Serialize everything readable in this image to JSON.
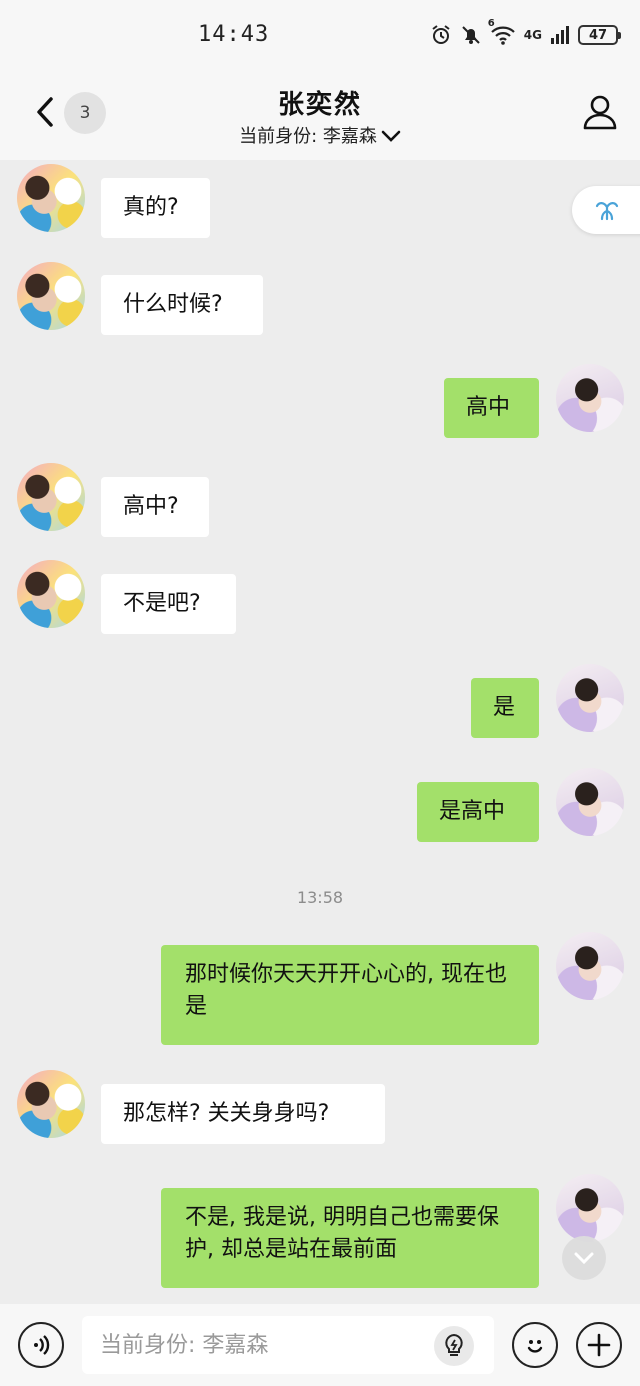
{
  "status_bar": {
    "time": "14:43",
    "network_label": "4G",
    "signal_label": "6",
    "battery": "47"
  },
  "header": {
    "unread_count": "3",
    "title": "张奕然",
    "identity_label": "当前身份: 李嘉森"
  },
  "messages": [
    {
      "side": "left",
      "text": "真的?"
    },
    {
      "side": "left",
      "text": "什么时候?"
    },
    {
      "side": "right",
      "text": "高中"
    },
    {
      "side": "left",
      "text": "高中?"
    },
    {
      "side": "left",
      "text": "不是吧?"
    },
    {
      "side": "right",
      "text": "是"
    },
    {
      "side": "right",
      "text": "是高中"
    },
    {
      "side": "right",
      "text": "那时候你天天开开心心的, 现在也是"
    },
    {
      "side": "left",
      "text": "那怎样? 关关身身吗?"
    },
    {
      "side": "right",
      "text": "不是, 我是说, 明明自己也需要保护, 却总是站在最前面"
    }
  ],
  "time_divider": "13:58",
  "input_bar": {
    "placeholder": "当前身份: 李嘉森"
  },
  "colors": {
    "background": "#ededed",
    "bubble_self": "#a3e06a",
    "bubble_other": "#ffffff"
  },
  "icons": [
    "back-arrow-icon",
    "person-icon",
    "chevron-down-icon",
    "voice-icon",
    "bulb-icon",
    "emoji-icon",
    "plus-icon",
    "chevron-down-icon",
    "alarm-icon",
    "mute-icon",
    "wifi-icon",
    "signal-icon",
    "battery-icon"
  ]
}
